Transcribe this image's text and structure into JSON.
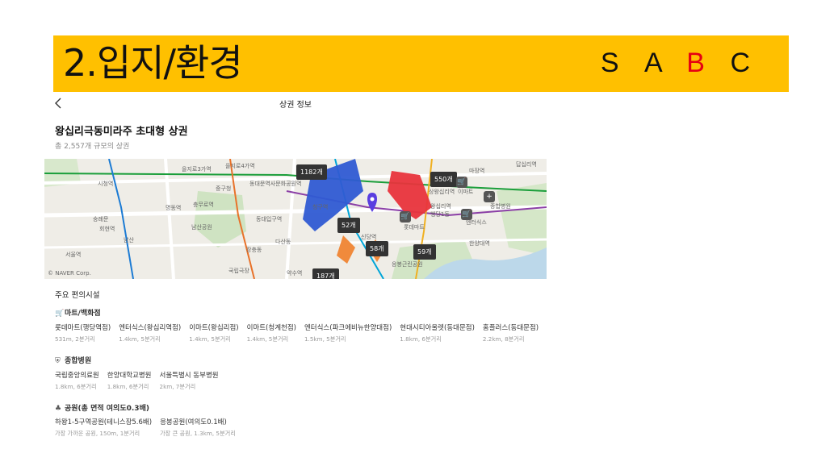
{
  "banner": {
    "title": "2.입지/환경",
    "grades": [
      "S",
      "A",
      "B",
      "C"
    ],
    "active_grade": "B",
    "background_color": "#ffc000",
    "active_color": "#e60012"
  },
  "topbar": {
    "title": "상권 정보",
    "back_icon": "chevron-left-icon"
  },
  "area": {
    "title": "왕십리극동미라주 초대형 상권",
    "subtitle": "총 2,557개 규모의 상권"
  },
  "map": {
    "clusters": [
      "1182개",
      "550개",
      "52개",
      "58개",
      "59개",
      "187개"
    ],
    "labels": [
      "을지로3가역",
      "을지로4가역",
      "동대문역사문화공원역",
      "중구청",
      "동대입구역",
      "청구역",
      "신당역",
      "상왕십리역",
      "왕십리역",
      "행당1동",
      "마장역",
      "한양대역",
      "명동역",
      "충무로역",
      "남산공원",
      "장충동",
      "약수역",
      "국립극장",
      "시청역",
      "숭례문",
      "회현역",
      "남산",
      "서울역",
      "다산동",
      "이마트",
      "종합병원",
      "엔터식스",
      "롯데마트",
      "응봉근린공원",
      "답십리역"
    ],
    "copyright": "© NAVER Corp.",
    "region_colors": {
      "blue": "#2f5bd3",
      "red": "#e8343c",
      "orange": "#f08a3c",
      "marker": "#5a3fe0"
    }
  },
  "facilities": {
    "title": "주요 편의시설",
    "marts": {
      "title": "마트/백화점",
      "icon": "shopping-cart-icon",
      "items": [
        {
          "name": "롯데마트(행당역점)",
          "detail": "531m, 2분거리"
        },
        {
          "name": "엔터식스(왕십리역점)",
          "detail": "1.4km, 5분거리"
        },
        {
          "name": "이마트(왕십리점)",
          "detail": "1.4km, 5분거리"
        },
        {
          "name": "이마트(청계천점)",
          "detail": "1.4km, 5분거리"
        },
        {
          "name": "엔터식스(파크에비뉴한양대점)",
          "detail": "1.5km, 5분거리"
        },
        {
          "name": "현대시티아울렛(동대문점)",
          "detail": "1.8km, 6분거리"
        },
        {
          "name": "홈플러스(동대문점)",
          "detail": "2.2km, 8분거리"
        }
      ]
    },
    "hospitals": {
      "title": "종합병원",
      "icon": "hospital-icon",
      "items": [
        {
          "name": "국립중앙의료원",
          "detail": "1.8km, 6분거리"
        },
        {
          "name": "한양대학교병원",
          "detail": "1.8km, 6분거리"
        },
        {
          "name": "서울특별시 동부병원",
          "detail": "2km, 7분거리"
        }
      ]
    },
    "parks": {
      "title": "공원(총 면적 여의도0.3배)",
      "icon": "park-icon",
      "items": [
        {
          "name": "하왕1-5구역공원(테니스장5.6배)",
          "detail": "가장 가까운 공원, 150m, 1분거리"
        },
        {
          "name": "응봉공원(여의도0.1배)",
          "detail": "가장 큰 공원, 1.3km, 5분거리"
        }
      ]
    }
  }
}
